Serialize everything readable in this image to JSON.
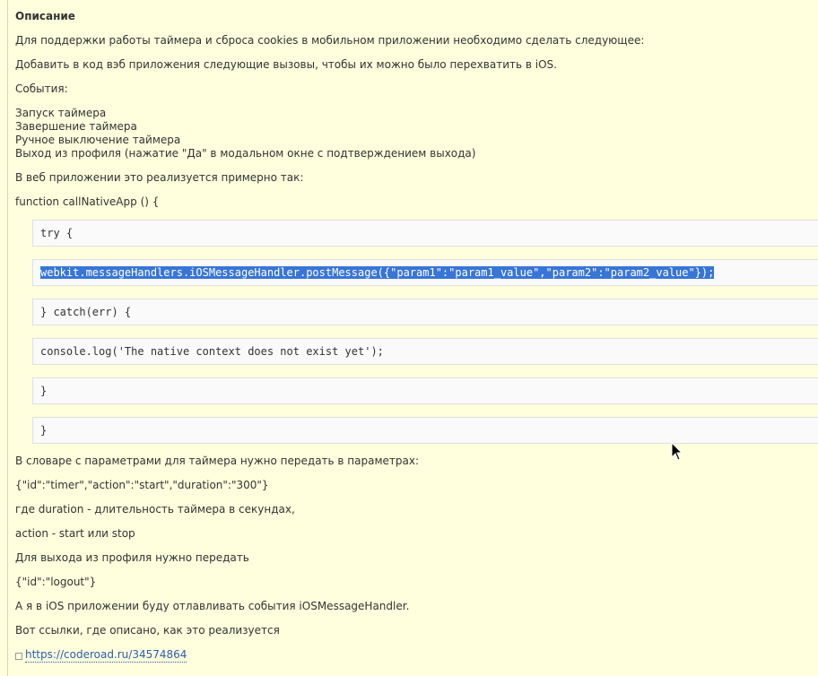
{
  "description": {
    "heading": "Описание",
    "p1": "Для поддержки работы таймера и сброса cookies в мобильном приложении необходимо сделать следующее:",
    "p2": "Добавить в код вэб приложения следующие вызовы, чтобы их можно было перехватить в iOS.",
    "events_label": "События:",
    "events": [
      "Запуск таймера",
      "Завершение таймера",
      "Ручное выключение таймера",
      "Выход из профиля (нажатие \"Да\" в модальном окне с подтверждением выхода)"
    ],
    "impl_intro": "В веб приложении это реализуется примерно так:",
    "func_decl": "function callNativeApp () {"
  },
  "code_lines": [
    "try {",
    "webkit.messageHandlers.iOSMessageHandler.postMessage({\"param1\":\"param1_value\",\"param2\":\"param2_value\"});",
    "} catch(err) {",
    "console.log('The native context does not exist yet');",
    "}",
    "}"
  ],
  "after": {
    "dict_intro": "В словаре с параметрами для таймера нужно передать в параметрах:",
    "timer_json": "{\"id\":\"timer\",\"action\":\"start\",\"duration\":\"300\"}",
    "duration_desc": "где duration - длительность таймера в секундах,",
    "action_desc": "action - start или stop",
    "logout_intro": "Для выхода из профиля нужно передать",
    "logout_json": "{\"id\":\"logout\"}",
    "ios_note": "А я в iOS приложении буду отлавливать события iOSMessageHandler.",
    "links_intro": "Вот ссылки, где описано, как это реализуется",
    "link": "https://coderoad.ru/34574864"
  },
  "colors": {
    "background": "#ffffdd",
    "selection": "#3875d7",
    "link": "#2a5db0"
  }
}
